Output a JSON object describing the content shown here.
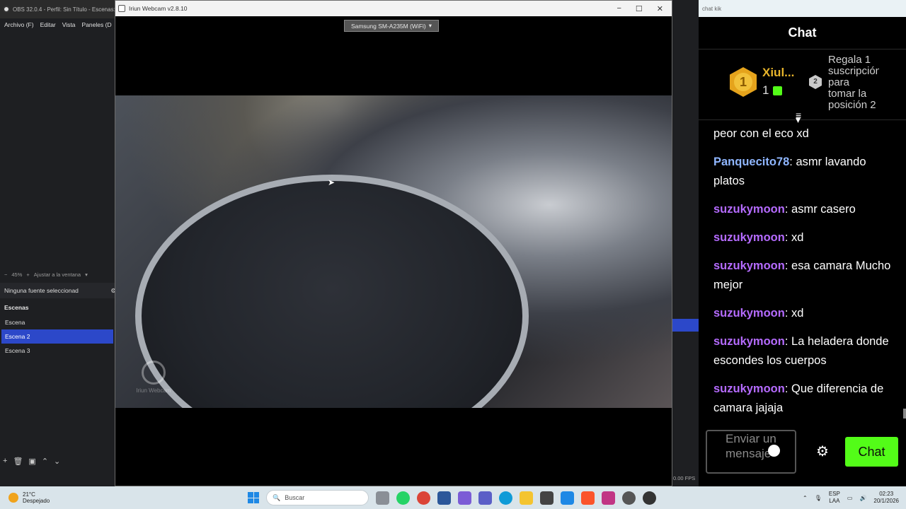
{
  "obs": {
    "title": "OBS 32.0.4 - Perfil: Sin Título - Escenas:",
    "menu": [
      "Archivo (F)",
      "Editar",
      "Vista",
      "Paneles (D"
    ],
    "zoom": "45%",
    "fit_label": "Ajustar a la ventana",
    "no_source": "Ninguna fuente seleccionad",
    "scenes_header": "Escenas",
    "scenes": [
      "Escena",
      "Escena 2",
      "Escena 3"
    ],
    "active_scene": "Escena 2",
    "fps": "0.00 FPS"
  },
  "iriun": {
    "title": "Iriun Webcam v2.8.10",
    "device": "Samsung SM-A235M (WiFi)",
    "watermark": "Iriun Webcam"
  },
  "chat": {
    "window_title": "chat kik",
    "header": "Chat",
    "leaderboard": {
      "first_name": "Xiul...",
      "first_count": "1",
      "rank1": "1",
      "rank2": "2",
      "gift_text": "Regala 1 suscripción para tomar la posición 2"
    },
    "messages": [
      {
        "user": "",
        "text": "peor con el eco xd",
        "color": "#ffffff"
      },
      {
        "user": "Panquecito78",
        "text": ": asmr lavando platos",
        "color": "#8fb6ff"
      },
      {
        "user": "suzukymoon",
        "text": ": asmr casero",
        "color": "#b56bff"
      },
      {
        "user": "suzukymoon",
        "text": ": xd",
        "color": "#b56bff"
      },
      {
        "user": "suzukymoon",
        "text": ": esa camara Mucho mejor",
        "color": "#b56bff"
      },
      {
        "user": "suzukymoon",
        "text": ": xd",
        "color": "#b56bff"
      },
      {
        "user": "suzukymoon",
        "text": ": La heladera donde escondes los cuerpos",
        "color": "#b56bff"
      },
      {
        "user": "suzukymoon",
        "text": ": Que diferencia de camara jajaja",
        "color": "#b56bff"
      }
    ],
    "input_placeholder": "Enviar un mensaje",
    "send_label": "Chat",
    "accent": "#53fc18"
  },
  "taskbar": {
    "temp": "21°C",
    "weather": "Despejado",
    "search_placeholder": "Buscar",
    "lang1": "ESP",
    "lang2": "LAA",
    "time": "02:23",
    "date": "20/1/2026"
  }
}
